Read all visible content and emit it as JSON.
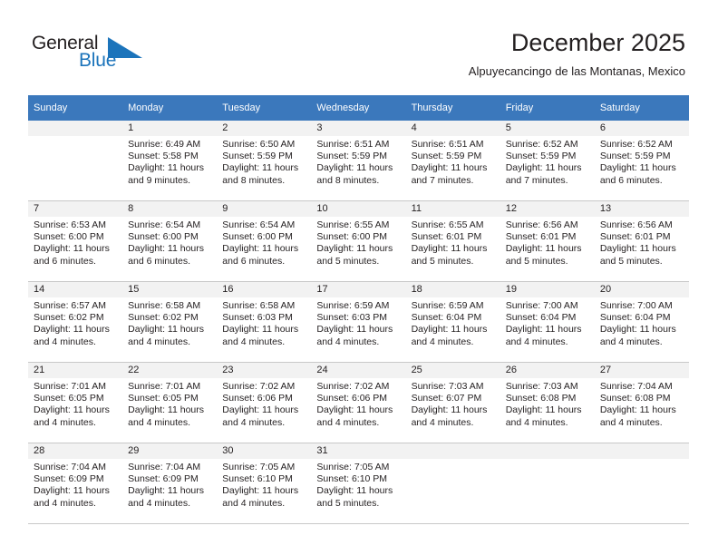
{
  "brand": {
    "name_part1": "General",
    "name_part2": "Blue",
    "accent_color": "#1c74bb"
  },
  "header": {
    "title": "December 2025",
    "subtitle": "Alpuyecancingo de las Montanas, Mexico",
    "header_bg_color": "#3b78bc"
  },
  "weekdays": [
    "Sunday",
    "Monday",
    "Tuesday",
    "Wednesday",
    "Thursday",
    "Friday",
    "Saturday"
  ],
  "weeks": [
    [
      {
        "day": "",
        "sunrise": "",
        "sunset": "",
        "daylight1": "",
        "daylight2": ""
      },
      {
        "day": "1",
        "sunrise": "Sunrise: 6:49 AM",
        "sunset": "Sunset: 5:58 PM",
        "daylight1": "Daylight: 11 hours",
        "daylight2": "and 9 minutes."
      },
      {
        "day": "2",
        "sunrise": "Sunrise: 6:50 AM",
        "sunset": "Sunset: 5:59 PM",
        "daylight1": "Daylight: 11 hours",
        "daylight2": "and 8 minutes."
      },
      {
        "day": "3",
        "sunrise": "Sunrise: 6:51 AM",
        "sunset": "Sunset: 5:59 PM",
        "daylight1": "Daylight: 11 hours",
        "daylight2": "and 8 minutes."
      },
      {
        "day": "4",
        "sunrise": "Sunrise: 6:51 AM",
        "sunset": "Sunset: 5:59 PM",
        "daylight1": "Daylight: 11 hours",
        "daylight2": "and 7 minutes."
      },
      {
        "day": "5",
        "sunrise": "Sunrise: 6:52 AM",
        "sunset": "Sunset: 5:59 PM",
        "daylight1": "Daylight: 11 hours",
        "daylight2": "and 7 minutes."
      },
      {
        "day": "6",
        "sunrise": "Sunrise: 6:52 AM",
        "sunset": "Sunset: 5:59 PM",
        "daylight1": "Daylight: 11 hours",
        "daylight2": "and 6 minutes."
      }
    ],
    [
      {
        "day": "7",
        "sunrise": "Sunrise: 6:53 AM",
        "sunset": "Sunset: 6:00 PM",
        "daylight1": "Daylight: 11 hours",
        "daylight2": "and 6 minutes."
      },
      {
        "day": "8",
        "sunrise": "Sunrise: 6:54 AM",
        "sunset": "Sunset: 6:00 PM",
        "daylight1": "Daylight: 11 hours",
        "daylight2": "and 6 minutes."
      },
      {
        "day": "9",
        "sunrise": "Sunrise: 6:54 AM",
        "sunset": "Sunset: 6:00 PM",
        "daylight1": "Daylight: 11 hours",
        "daylight2": "and 6 minutes."
      },
      {
        "day": "10",
        "sunrise": "Sunrise: 6:55 AM",
        "sunset": "Sunset: 6:00 PM",
        "daylight1": "Daylight: 11 hours",
        "daylight2": "and 5 minutes."
      },
      {
        "day": "11",
        "sunrise": "Sunrise: 6:55 AM",
        "sunset": "Sunset: 6:01 PM",
        "daylight1": "Daylight: 11 hours",
        "daylight2": "and 5 minutes."
      },
      {
        "day": "12",
        "sunrise": "Sunrise: 6:56 AM",
        "sunset": "Sunset: 6:01 PM",
        "daylight1": "Daylight: 11 hours",
        "daylight2": "and 5 minutes."
      },
      {
        "day": "13",
        "sunrise": "Sunrise: 6:56 AM",
        "sunset": "Sunset: 6:01 PM",
        "daylight1": "Daylight: 11 hours",
        "daylight2": "and 5 minutes."
      }
    ],
    [
      {
        "day": "14",
        "sunrise": "Sunrise: 6:57 AM",
        "sunset": "Sunset: 6:02 PM",
        "daylight1": "Daylight: 11 hours",
        "daylight2": "and 4 minutes."
      },
      {
        "day": "15",
        "sunrise": "Sunrise: 6:58 AM",
        "sunset": "Sunset: 6:02 PM",
        "daylight1": "Daylight: 11 hours",
        "daylight2": "and 4 minutes."
      },
      {
        "day": "16",
        "sunrise": "Sunrise: 6:58 AM",
        "sunset": "Sunset: 6:03 PM",
        "daylight1": "Daylight: 11 hours",
        "daylight2": "and 4 minutes."
      },
      {
        "day": "17",
        "sunrise": "Sunrise: 6:59 AM",
        "sunset": "Sunset: 6:03 PM",
        "daylight1": "Daylight: 11 hours",
        "daylight2": "and 4 minutes."
      },
      {
        "day": "18",
        "sunrise": "Sunrise: 6:59 AM",
        "sunset": "Sunset: 6:04 PM",
        "daylight1": "Daylight: 11 hours",
        "daylight2": "and 4 minutes."
      },
      {
        "day": "19",
        "sunrise": "Sunrise: 7:00 AM",
        "sunset": "Sunset: 6:04 PM",
        "daylight1": "Daylight: 11 hours",
        "daylight2": "and 4 minutes."
      },
      {
        "day": "20",
        "sunrise": "Sunrise: 7:00 AM",
        "sunset": "Sunset: 6:04 PM",
        "daylight1": "Daylight: 11 hours",
        "daylight2": "and 4 minutes."
      }
    ],
    [
      {
        "day": "21",
        "sunrise": "Sunrise: 7:01 AM",
        "sunset": "Sunset: 6:05 PM",
        "daylight1": "Daylight: 11 hours",
        "daylight2": "and 4 minutes."
      },
      {
        "day": "22",
        "sunrise": "Sunrise: 7:01 AM",
        "sunset": "Sunset: 6:05 PM",
        "daylight1": "Daylight: 11 hours",
        "daylight2": "and 4 minutes."
      },
      {
        "day": "23",
        "sunrise": "Sunrise: 7:02 AM",
        "sunset": "Sunset: 6:06 PM",
        "daylight1": "Daylight: 11 hours",
        "daylight2": "and 4 minutes."
      },
      {
        "day": "24",
        "sunrise": "Sunrise: 7:02 AM",
        "sunset": "Sunset: 6:06 PM",
        "daylight1": "Daylight: 11 hours",
        "daylight2": "and 4 minutes."
      },
      {
        "day": "25",
        "sunrise": "Sunrise: 7:03 AM",
        "sunset": "Sunset: 6:07 PM",
        "daylight1": "Daylight: 11 hours",
        "daylight2": "and 4 minutes."
      },
      {
        "day": "26",
        "sunrise": "Sunrise: 7:03 AM",
        "sunset": "Sunset: 6:08 PM",
        "daylight1": "Daylight: 11 hours",
        "daylight2": "and 4 minutes."
      },
      {
        "day": "27",
        "sunrise": "Sunrise: 7:04 AM",
        "sunset": "Sunset: 6:08 PM",
        "daylight1": "Daylight: 11 hours",
        "daylight2": "and 4 minutes."
      }
    ],
    [
      {
        "day": "28",
        "sunrise": "Sunrise: 7:04 AM",
        "sunset": "Sunset: 6:09 PM",
        "daylight1": "Daylight: 11 hours",
        "daylight2": "and 4 minutes."
      },
      {
        "day": "29",
        "sunrise": "Sunrise: 7:04 AM",
        "sunset": "Sunset: 6:09 PM",
        "daylight1": "Daylight: 11 hours",
        "daylight2": "and 4 minutes."
      },
      {
        "day": "30",
        "sunrise": "Sunrise: 7:05 AM",
        "sunset": "Sunset: 6:10 PM",
        "daylight1": "Daylight: 11 hours",
        "daylight2": "and 4 minutes."
      },
      {
        "day": "31",
        "sunrise": "Sunrise: 7:05 AM",
        "sunset": "Sunset: 6:10 PM",
        "daylight1": "Daylight: 11 hours",
        "daylight2": "and 5 minutes."
      },
      {
        "day": "",
        "sunrise": "",
        "sunset": "",
        "daylight1": "",
        "daylight2": ""
      },
      {
        "day": "",
        "sunrise": "",
        "sunset": "",
        "daylight1": "",
        "daylight2": ""
      },
      {
        "day": "",
        "sunrise": "",
        "sunset": "",
        "daylight1": "",
        "daylight2": ""
      }
    ]
  ]
}
